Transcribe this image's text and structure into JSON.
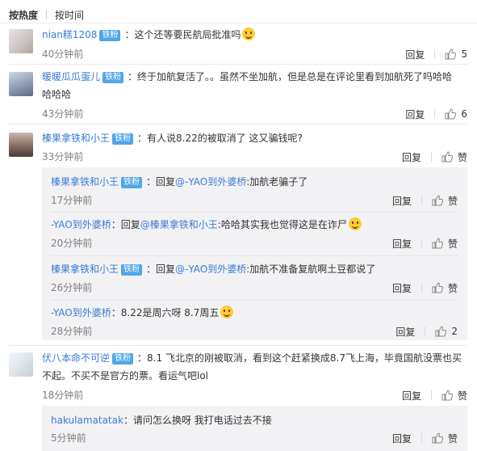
{
  "tabs": {
    "hot": "按热度",
    "time": "按时间"
  },
  "labels": {
    "reply": "回复",
    "like": "赞"
  },
  "comments": [
    {
      "user": "nian糕1208",
      "badge": "铁粉",
      "text": "：这个还等要民航局批准吗",
      "time": "40分钟前",
      "likes": "5"
    },
    {
      "user": "暖暖瓜瓜蛋儿",
      "badge": "铁粉",
      "text1": "：终于加航复活了。。虽然不坐加航，但是总是在评论里看到加航死了吗哈哈",
      "text2": "哈哈哈",
      "time": "43分钟前",
      "likes": "6"
    },
    {
      "user": "榛果拿铁和小王",
      "badge": "铁粉",
      "text": "：有人说8.22的被取消了 这又骗钱呢?",
      "time": "33分钟前"
    },
    {
      "user": "伏八本命不可逆",
      "badge": "铁粉",
      "text1": "：8.1 飞北京的刚被取消，看到这个赶紧换成8.7飞上海，毕竟国航没票也买",
      "text2": "不起。不买不是官方的票。看运气吧lol",
      "time": "18分钟前"
    }
  ],
  "replies1": [
    {
      "user": "榛果拿铁和小王",
      "badge": "铁粉",
      "pre": "：回复",
      "at": "@-YAO到外婆桥",
      "text": ":加航老骗子了",
      "time": "17分钟前"
    },
    {
      "user": "-YAO到外婆桥",
      "pre": "：回复",
      "at": "@榛果拿铁和小王",
      "text": ":哈哈其实我也觉得这是在诈尸",
      "time": "20分钟前"
    },
    {
      "user": "榛果拿铁和小王",
      "badge": "铁粉",
      "pre": "：回复",
      "at": "@-YAO到外婆桥",
      "text": ":加航不准备复航啊土豆都说了",
      "time": "26分钟前"
    },
    {
      "user": "-YAO到外婆桥",
      "text": "：8.22是周六呀 8.7周五",
      "time": "28分钟前",
      "likes": "2"
    }
  ],
  "replies2": [
    {
      "user": "hakulamatatak",
      "text": "：请问怎么换呀 我打电话过去不接",
      "time": "5分钟前"
    }
  ]
}
